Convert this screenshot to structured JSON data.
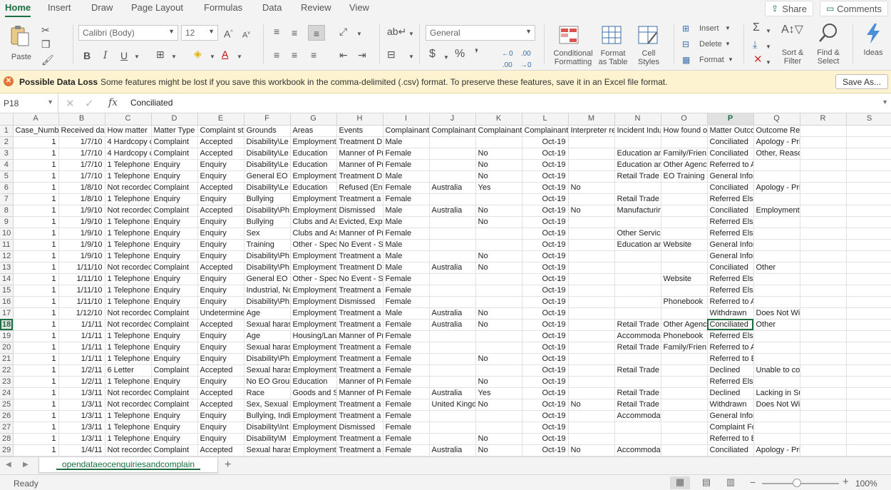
{
  "tabs": [
    "Home",
    "Insert",
    "Draw",
    "Page Layout",
    "Formulas",
    "Data",
    "Review",
    "View"
  ],
  "share_label": "Share",
  "comments_label": "Comments",
  "ribbon": {
    "paste": "Paste",
    "font_name": "Calibri (Body)",
    "font_size": "12",
    "number_format": "General",
    "conditional_formatting": [
      "Conditional",
      "Formatting"
    ],
    "format_as_table": [
      "Format",
      "as Table"
    ],
    "cell_styles": [
      "Cell",
      "Styles"
    ],
    "insert": "Insert",
    "delete": "Delete",
    "format": "Format",
    "sort_filter": [
      "Sort &",
      "Filter"
    ],
    "find_select": [
      "Find &",
      "Select"
    ],
    "ideas": "Ideas"
  },
  "message_bar": {
    "title": "Possible Data Loss",
    "text": "Some features might be lost if you save this workbook in the comma-delimited (.csv) format. To preserve these features, save it in an Excel file format.",
    "button": "Save As..."
  },
  "formula_bar": {
    "cell_ref": "P18",
    "fx": "fx",
    "value": "Conciliated"
  },
  "selected_col": "P",
  "selected_row": 18,
  "columns": [
    "A",
    "B",
    "C",
    "D",
    "E",
    "F",
    "G",
    "H",
    "I",
    "J",
    "K",
    "L",
    "M",
    "N",
    "O",
    "P",
    "Q",
    "R",
    "S"
  ],
  "rows": [
    [
      "Case_Number",
      "Received date",
      "How matter",
      "Matter Type",
      "Complaint st",
      "Grounds",
      "Areas",
      "Events",
      "Complainant",
      "Complainant",
      "Complainant",
      "Complainant",
      "Interpreter re",
      "Incident Indu",
      "How found o",
      "Matter Outco",
      "Outcome Reasons (complaints only)",
      "",
      ""
    ],
    [
      "1",
      "1/7/10",
      "4 Hardcopy c",
      "Complaint",
      "Accepted",
      "Disability\\Le",
      "Employment",
      "Treatment D",
      "Male",
      "",
      "",
      "Oct-19",
      "",
      "",
      "",
      "Conciliated",
      "Apology - Private, Policy Change/Change",
      "",
      ""
    ],
    [
      "1",
      "1/7/10",
      "4 Hardcopy c",
      "Complaint",
      "Accepted",
      "Disability\\Le",
      "Education",
      "Manner of Pr",
      "Female",
      "",
      "No",
      "Oct-19",
      "",
      "Education an",
      "Family/Frien",
      "Conciliated",
      "Other, Reasonable Adjustment",
      "",
      ""
    ],
    [
      "1",
      "1/7/10",
      "1 Telephone",
      "Enquiry",
      "Enquiry",
      "Disability\\Le",
      "Education",
      "Manner of Pr",
      "Female",
      "",
      "No",
      "Oct-19",
      "",
      "Education an",
      "Other Agenc",
      "Referred to Advocate (to Assist with EO/Other Issue",
      "",
      "",
      ""
    ],
    [
      "1",
      "1/7/10",
      "1 Telephone",
      "Enquiry",
      "Enquiry",
      "General EO I",
      "Employment",
      "Treatment D",
      "Male",
      "",
      "No",
      "Oct-19",
      "",
      "Retail Trade",
      "EO Training",
      "General Information Provided",
      "",
      "",
      ""
    ],
    [
      "1",
      "1/8/10",
      "Not recordec",
      "Complaint",
      "Accepted",
      "Disability\\Le",
      "Education",
      "Refused (Ent",
      "Female",
      "Australia",
      "Yes",
      "Oct-19",
      "No",
      "",
      "",
      "Conciliated",
      "Apology - Private, Financial Compensat",
      "",
      ""
    ],
    [
      "1",
      "1/8/10",
      "1 Telephone",
      "Enquiry",
      "Enquiry",
      "Bullying",
      "Employment",
      "Treatment a",
      "Female",
      "",
      "",
      "Oct-19",
      "",
      "Retail Trade",
      "",
      "Referred Elsewhere (Out of EO Jurisdiction)",
      "",
      "",
      ""
    ],
    [
      "1",
      "1/9/10",
      "Not recordec",
      "Complaint",
      "Accepted",
      "Disability\\Ph",
      "Employment",
      "Dismissed",
      "Male",
      "Australia",
      "No",
      "Oct-19",
      "No",
      "Manufacturing",
      "",
      "Conciliated",
      "Employment Options Improved - Job O",
      "",
      ""
    ],
    [
      "1",
      "1/9/10",
      "1 Telephone",
      "Enquiry",
      "Enquiry",
      "Bullying",
      "Clubs and As",
      "Evicted, Expe",
      "Male",
      "",
      "No",
      "Oct-19",
      "",
      "",
      "",
      "Referred Elsewhere (Out of EO Jurisdiction)",
      "",
      "",
      ""
    ],
    [
      "1",
      "1/9/10",
      "1 Telephone",
      "Enquiry",
      "Enquiry",
      "Sex",
      "Clubs and As",
      "Manner of Pr",
      "Female",
      "",
      "",
      "Oct-19",
      "",
      "Other Services",
      "",
      "Referred Elsewhere (Out of EO Jurisdiction)",
      "",
      "",
      ""
    ],
    [
      "1",
      "1/9/10",
      "1 Telephone",
      "Enquiry",
      "Enquiry",
      "Training",
      "Other - Spec",
      "No Event - S",
      "Male",
      "",
      "",
      "Oct-19",
      "",
      "Education an",
      "Website",
      "General Information Provided",
      "",
      "",
      ""
    ],
    [
      "1",
      "1/9/10",
      "1 Telephone",
      "Enquiry",
      "Enquiry",
      "Disability\\Ph",
      "Employment",
      "Treatment a",
      "Male",
      "",
      "No",
      "Oct-19",
      "",
      "",
      "",
      "General Information Provided",
      "",
      "",
      ""
    ],
    [
      "1",
      "1/11/10",
      "Not recordec",
      "Complaint",
      "Accepted",
      "Disability\\Ph",
      "Employment",
      "Treatment D",
      "Male",
      "Australia",
      "No",
      "Oct-19",
      "",
      "",
      "",
      "Conciliated",
      "Other",
      "",
      ""
    ],
    [
      "1",
      "1/11/10",
      "1 Telephone",
      "Enquiry",
      "Enquiry",
      "General EO I",
      "Other - Spec",
      "No Event - S",
      "Female",
      "",
      "",
      "Oct-19",
      "",
      "",
      "Website",
      "Referred Elsewhere (Out of EO Jurisdiction)",
      "",
      "",
      ""
    ],
    [
      "1",
      "1/11/10",
      "1 Telephone",
      "Enquiry",
      "Enquiry",
      "Industrial, No",
      "Employment",
      "Treatment a",
      "Female",
      "",
      "",
      "Oct-19",
      "",
      "",
      "",
      "Referred Elsewhere (Out of EO Jurisdiction)",
      "",
      "",
      ""
    ],
    [
      "1",
      "1/11/10",
      "1 Telephone",
      "Enquiry",
      "Enquiry",
      "Disability\\Ph",
      "Employment",
      "Dismissed",
      "Female",
      "",
      "",
      "Oct-19",
      "",
      "",
      "Phonebook",
      "Referred to Advocate (to Assist with EO/Other Issue",
      "",
      "",
      ""
    ],
    [
      "1",
      "1/12/10",
      "Not recordec",
      "Complaint",
      "Undetermine",
      "Age",
      "Employment",
      "Treatment a",
      "Male",
      "Australia",
      "No",
      "Oct-19",
      "",
      "",
      "",
      "Withdrawn",
      "Does Not Wish to Pursue - Advises Com",
      "",
      ""
    ],
    [
      "1",
      "1/1/11",
      "Not recordec",
      "Complaint",
      "Accepted",
      "Sexual haras",
      "Employment",
      "Treatment a",
      "Female",
      "Australia",
      "No",
      "Oct-19",
      "",
      "Retail Trade",
      "Other Agenc",
      "Conciliated",
      "Other",
      "",
      ""
    ],
    [
      "1",
      "1/1/11",
      "1 Telephone",
      "Enquiry",
      "Enquiry",
      "Age",
      "Housing/Lan",
      "Manner of Pr",
      "Female",
      "",
      "",
      "Oct-19",
      "",
      "Accommoda",
      "Phonebook",
      "Referred Elsewhere (Out of EO Jurisdiction)",
      "",
      "",
      ""
    ],
    [
      "1",
      "1/1/11",
      "1 Telephone",
      "Enquiry",
      "Enquiry",
      "Sexual haras",
      "Employment",
      "Treatment a",
      "Female",
      "",
      "",
      "Oct-19",
      "",
      "Retail Trade",
      "Family/Frien",
      "Referred to Advocate (to Assist with EO/Other Issue",
      "",
      "",
      ""
    ],
    [
      "1",
      "1/1/11",
      "1 Telephone",
      "Enquiry",
      "Enquiry",
      "Disability\\Ph",
      "Employment",
      "Treatment a",
      "Female",
      "",
      "No",
      "Oct-19",
      "",
      "",
      "",
      "Referred to EOC Website",
      "",
      "",
      ""
    ],
    [
      "1",
      "1/2/11",
      "6 Letter",
      "Complaint",
      "Accepted",
      "Sexual haras",
      "Employment",
      "Treatment a",
      "Female",
      "",
      "",
      "Oct-19",
      "",
      "Retail Trade",
      "",
      "Declined",
      "Unable to contact complainant",
      "",
      ""
    ],
    [
      "1",
      "1/2/11",
      "1 Telephone",
      "Enquiry",
      "Enquiry",
      "No EO Grour",
      "Education",
      "Manner of Pr",
      "Female",
      "",
      "No",
      "Oct-19",
      "",
      "",
      "",
      "Referred Elsewhere (Out of EO Jurisdiction)",
      "",
      "",
      ""
    ],
    [
      "1",
      "1/3/11",
      "Not recordec",
      "Complaint",
      "Accepted",
      "Race",
      "Goods and S",
      "Manner of Pr",
      "Female",
      "Australia",
      "Yes",
      "Oct-19",
      "",
      "Retail Trade",
      "",
      "Declined",
      "Lacking in Substance",
      "",
      ""
    ],
    [
      "1",
      "1/3/11",
      "Not recordec",
      "Complaint",
      "Accepted",
      "Sex, Sexual I",
      "Employment",
      "Treatment a",
      "Female",
      "United Kingd",
      "No",
      "Oct-19",
      "No",
      "Retail Trade",
      "",
      "Withdrawn",
      "Does Not Wish to Pursue - Advises Com",
      "",
      ""
    ],
    [
      "1",
      "1/3/11",
      "1 Telephone",
      "Enquiry",
      "Enquiry",
      "Bullying, Indi",
      "Employment",
      "Treatment a",
      "Female",
      "",
      "",
      "Oct-19",
      "",
      "Accommodation and Food",
      "",
      "General Information Provided",
      "",
      "",
      ""
    ],
    [
      "1",
      "1/3/11",
      "1 Telephone",
      "Enquiry",
      "Enquiry",
      "Disability\\Int",
      "Employment",
      "Dismissed",
      "Female",
      "",
      "",
      "Oct-19",
      "",
      "",
      "",
      "Complaint Form & Information Package Sent",
      "",
      "",
      ""
    ],
    [
      "1",
      "1/3/11",
      "1 Telephone",
      "Enquiry",
      "Enquiry",
      "Disability\\M",
      "Employment",
      "Treatment a",
      "Female",
      "",
      "No",
      "Oct-19",
      "",
      "",
      "",
      "Referred to EOC Electronic Complaint Form",
      "",
      "",
      ""
    ],
    [
      "1",
      "1/4/11",
      "Not recordec",
      "Complaint",
      "Accepted",
      "Sexual haras",
      "Employment",
      "Treatment a",
      "Female",
      "Australia",
      "No",
      "Oct-19",
      "No",
      "Accommodation and Food",
      "",
      "Conciliated",
      "Apology - Private, Other, Staff Training",
      "",
      ""
    ]
  ],
  "sheet_tab": "opendataeocenquiriesandcomplain",
  "status": "Ready",
  "zoom": "100%"
}
